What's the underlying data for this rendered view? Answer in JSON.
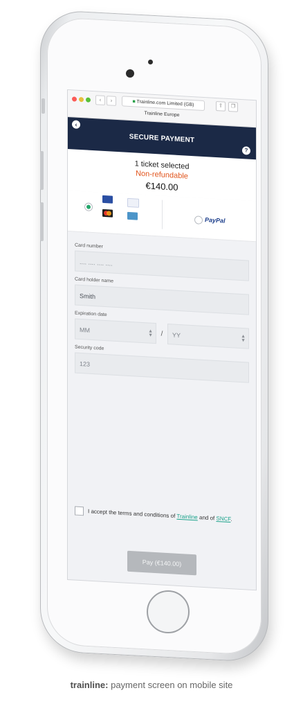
{
  "browser": {
    "url_text": "Trainline.com Limited (GB)",
    "tab_title": "Trainline Europe",
    "back_glyph": "‹",
    "forward_glyph": "›"
  },
  "header": {
    "title": "SECURE PAYMENT",
    "back_icon": "chevron-left-icon",
    "help_icon": "question-icon",
    "help_glyph": "?"
  },
  "summary": {
    "tickets": "1 ticket selected",
    "refund": "Non-refundable",
    "price": "€140.00"
  },
  "payment_methods": {
    "selected": "card",
    "paypal_label": "PayPal"
  },
  "form": {
    "card_number": {
      "label": "Card number",
      "placeholder": ".... .... .... ...."
    },
    "card_holder": {
      "label": "Card holder name",
      "value": "Smith"
    },
    "expiration": {
      "label": "Expiration date",
      "month_placeholder": "MM",
      "year_placeholder": "YY",
      "separator": "/"
    },
    "security": {
      "label": "Security code",
      "placeholder": "123"
    }
  },
  "terms": {
    "text_before": "I accept the terms and conditions of",
    "link1": "Trainline",
    "text_middle": "and of",
    "link2": "SNCF",
    "text_after": "."
  },
  "pay_button": "Pay (€140.00)",
  "caption": {
    "brand": "trainline:",
    "text": " payment screen on mobile site"
  },
  "colors": {
    "header_bg": "#1b2946",
    "refund_orange": "#e1551d",
    "link_green": "#1aa28a"
  }
}
